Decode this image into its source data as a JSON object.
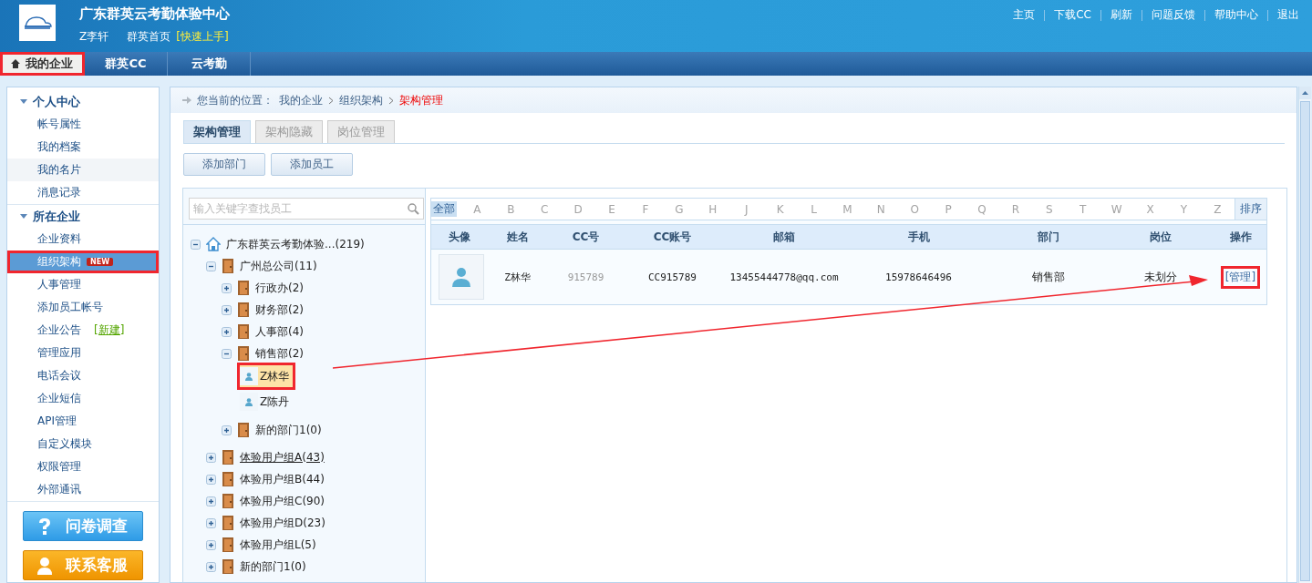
{
  "header": {
    "title": "广东群英云考勤体验中心",
    "user": "Z李轩",
    "home_link": "群英首页",
    "quick_start": "[快速上手]",
    "links": [
      "主页",
      "下载CC",
      "刷新",
      "问题反馈",
      "帮助中心",
      "退出"
    ]
  },
  "nav_tabs": [
    {
      "label": "我的企业",
      "selected": true,
      "marked": true
    },
    {
      "label": "群英CC",
      "selected": false,
      "marked": false
    },
    {
      "label": "云考勤",
      "selected": false,
      "marked": false
    }
  ],
  "sidebar": {
    "sections": [
      {
        "title": "个人中心",
        "items": [
          {
            "label": "帐号属性",
            "selected": false,
            "hover": false,
            "marked": false
          },
          {
            "label": "我的档案",
            "selected": false,
            "hover": false,
            "marked": false
          },
          {
            "label": "我的名片",
            "selected": false,
            "hover": true,
            "marked": false
          },
          {
            "label": "消息记录",
            "selected": false,
            "hover": false,
            "marked": false
          }
        ]
      },
      {
        "title": "所在企业",
        "items": [
          {
            "label": "企业资料",
            "selected": false,
            "hover": false,
            "marked": false
          },
          {
            "label": "组织架构",
            "badge": "NEW",
            "selected": true,
            "hover": false,
            "marked": true
          },
          {
            "label": "人事管理",
            "selected": false,
            "hover": false,
            "marked": false
          },
          {
            "label": "添加员工帐号",
            "selected": false,
            "hover": false,
            "marked": false
          },
          {
            "label": "企业公告",
            "link": "[新建]",
            "selected": false,
            "hover": false,
            "marked": false
          },
          {
            "label": "管理应用",
            "selected": false,
            "hover": false,
            "marked": false
          },
          {
            "label": "电话会议",
            "selected": false,
            "hover": false,
            "marked": false
          },
          {
            "label": "企业短信",
            "selected": false,
            "hover": false,
            "marked": false
          },
          {
            "label": "API管理",
            "selected": false,
            "hover": false,
            "marked": false
          },
          {
            "label": "自定义模块",
            "selected": false,
            "hover": false,
            "marked": false
          },
          {
            "label": "权限管理",
            "selected": false,
            "hover": false,
            "marked": false
          },
          {
            "label": "外部通讯",
            "selected": false,
            "hover": false,
            "marked": false
          }
        ]
      }
    ],
    "buttons": [
      {
        "kind": "survey",
        "label": "问卷调查"
      },
      {
        "kind": "service",
        "label": "联系客服"
      }
    ]
  },
  "breadcrumb": {
    "label": "您当前的位置：",
    "items": [
      "我的企业",
      "组织架构"
    ],
    "current": "架构管理"
  },
  "tabs": [
    {
      "label": "架构管理",
      "selected": true
    },
    {
      "label": "架构隐藏",
      "selected": false
    },
    {
      "label": "岗位管理",
      "selected": false
    }
  ],
  "actions": [
    "添加部门",
    "添加员工"
  ],
  "search": {
    "placeholder": "输入关键字查找员工"
  },
  "tree": [
    {
      "kind": "root",
      "label": "广东群英云考勤体验...(219)",
      "expanded": true,
      "children": [
        {
          "kind": "dept",
          "label": "广州总公司(11)",
          "expanded": true,
          "underlined": false,
          "children": [
            {
              "kind": "dept",
              "label": "行政办(2)",
              "expanded": false,
              "underlined": false
            },
            {
              "kind": "dept",
              "label": "财务部(2)",
              "expanded": false,
              "underlined": false
            },
            {
              "kind": "dept",
              "label": "人事部(4)",
              "expanded": false,
              "underlined": false
            },
            {
              "kind": "dept",
              "label": "销售部(2)",
              "expanded": true,
              "underlined": false,
              "children": [
                {
                  "kind": "person",
                  "label": "Z林华",
                  "selected": true,
                  "marked": true
                },
                {
                  "kind": "person",
                  "label": "Z陈丹",
                  "selected": false,
                  "marked": false
                }
              ]
            },
            {
              "kind": "dept",
              "label": "新的部门1(0)",
              "expanded": false,
              "underlined": false
            }
          ]
        },
        {
          "kind": "dept",
          "label": "体验用户组A(43)",
          "expanded": false,
          "underlined": true
        },
        {
          "kind": "dept",
          "label": "体验用户组B(44)",
          "expanded": false,
          "underlined": false
        },
        {
          "kind": "dept",
          "label": "体验用户组C(90)",
          "expanded": false,
          "underlined": false
        },
        {
          "kind": "dept",
          "label": "体验用户组D(23)",
          "expanded": false,
          "underlined": false
        },
        {
          "kind": "dept",
          "label": "体验用户组L(5)",
          "expanded": false,
          "underlined": false
        },
        {
          "kind": "dept",
          "label": "新的部门1(0)",
          "expanded": false,
          "underlined": false
        }
      ]
    }
  ],
  "letters": [
    {
      "label": "全部",
      "selected": true
    },
    {
      "label": "A",
      "selected": false
    },
    {
      "label": "B",
      "selected": false
    },
    {
      "label": "C",
      "selected": false
    },
    {
      "label": "D",
      "selected": false
    },
    {
      "label": "E",
      "selected": false
    },
    {
      "label": "F",
      "selected": false
    },
    {
      "label": "G",
      "selected": false
    },
    {
      "label": "H",
      "selected": false
    },
    {
      "label": "J",
      "selected": false
    },
    {
      "label": "K",
      "selected": false
    },
    {
      "label": "L",
      "selected": false
    },
    {
      "label": "M",
      "selected": false
    },
    {
      "label": "N",
      "selected": false
    },
    {
      "label": "O",
      "selected": false
    },
    {
      "label": "P",
      "selected": false
    },
    {
      "label": "Q",
      "selected": false
    },
    {
      "label": "R",
      "selected": false
    },
    {
      "label": "S",
      "selected": false
    },
    {
      "label": "T",
      "selected": false
    },
    {
      "label": "W",
      "selected": false
    },
    {
      "label": "X",
      "selected": false
    },
    {
      "label": "Y",
      "selected": false
    },
    {
      "label": "Z",
      "selected": false
    }
  ],
  "sort_button": "排序",
  "table": {
    "columns": [
      "头像",
      "姓名",
      "CC号",
      "CC账号",
      "邮箱",
      "手机",
      "部门",
      "岗位",
      "操作"
    ],
    "rows": [
      {
        "name": "Z林华",
        "cc_no": "915789",
        "cc_account": "CC915789",
        "email": "13455444778@qq.com",
        "phone": "15978646496",
        "department": "销售部",
        "position": "未划分",
        "action": "[管理]",
        "action_marked": true
      }
    ]
  },
  "annotation_arrow": true
}
